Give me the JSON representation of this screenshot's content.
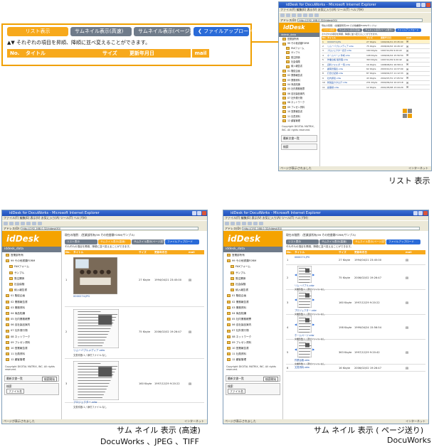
{
  "zoom": {
    "buttons": [
      "リスト表示",
      "サムネイル表示(高速)",
      "サムネイル表示(ページ送り)",
      "ファイルアップロード"
    ],
    "note": "それぞれの項目を昇順、降順に並べ変えることができます。",
    "columns": [
      "No.",
      "タイトル",
      "サイズ",
      "更新年月日",
      "mail"
    ]
  },
  "common": {
    "window_title": "idDesk for DocuWorks - Microsoft Internet Explorer",
    "menu": "ファイル(F) 編集(E) 表示(V) お気に入り(A) ツール(T) ヘルプ(H)",
    "address_label": "アドレス(D)",
    "address": "http://192.168.0.32/iddesk30/",
    "status": "ページが表示されました",
    "zone": "インターネット",
    "logo": "idDesk",
    "project": "iddesk_data",
    "breadcrumb": "現在の階層：/営業部所有/99 その他書類FORM/サンプル/",
    "tabs": [
      "リスト表示",
      "サムネイル表示(高速)",
      "サムネイル表示(ページ送り)",
      "ファイルアップロード"
    ],
    "note": "それぞれの項目を昇順、降順に並べ変えることができます。",
    "columns": [
      "No.",
      "タイトル",
      "サイズ",
      "更新年月日",
      "mail"
    ],
    "sidebar": [
      "営業部所有",
      "99 その他書類FORM",
      "FAXフォーム",
      "サンプル",
      "受注関係",
      "社会保険",
      "納入報告書",
      "01 販促企画",
      "02 業務報告書",
      "03 業務資料",
      "04 商品知識",
      "05 社内業務帳票",
      "06 自社製品案内",
      "07 社外発行物",
      "08 ネットワーク",
      "09 プレゼン資料",
      "10 営業報告書",
      "11 社員資料",
      "12 顧客管理"
    ],
    "copyright": "Copyright DIGITAL MATRIX, INC. All rights reserved.",
    "search_title": "最新文書一覧",
    "search_button": "検索開始",
    "search_title2": "検索",
    "search_field": "ファイル名"
  },
  "list_rows": [
    {
      "no": "1",
      "title": "0000274.JPG",
      "size": "27 Kbyte",
      "date": "1994/04/21 23:45:00"
    },
    {
      "no": "2",
      "title": "リムーバブルメディア.xdw",
      "size": "75 Kbyte",
      "date": "2006/02/02 19:26:47"
    },
    {
      "no": "3",
      "title": "プロジェクター表示.xdw",
      "size": "160 Kbyte",
      "date": "1997/12/29 9:20:22"
    },
    {
      "no": "4",
      "title": "ホームページ 作成.xdw",
      "size": "198 Kbyte",
      "date": "1999/04/24 15:56:54"
    },
    {
      "no": "5",
      "title": "作業台帳 版管理.xdw",
      "size": "363 Kbyte",
      "date": "1997/12/29 9:20:42"
    },
    {
      "no": "6",
      "title": "資料フォルダ 一覧.xdw",
      "size": "16 Kbyte",
      "date": "1998/06/01 16:58:11"
    },
    {
      "no": "7",
      "title": "顧客管理表.xdw",
      "size": "62 Kbyte",
      "date": "2003/12/11 14:37:09"
    },
    {
      "no": "8",
      "title": "打合せ記録.xdw",
      "size": "87 Kbyte",
      "date": "1999/02/17 11:12:33"
    },
    {
      "no": "9",
      "title": "社内通達.xdw",
      "size": "43 Kbyte",
      "date": "2002/07/31 17:05:52"
    },
    {
      "no": "10",
      "title": "新製品カタログ.xdw",
      "size": "231 Kbyte",
      "date": "2004/09/14 10:22:18"
    },
    {
      "no": "11",
      "title": "議事録.xdw",
      "size": "12 Kbyte",
      "date": "2001/05/08 13:44:29"
    }
  ],
  "fast_rows": [
    {
      "no": "1",
      "title": "0000274.JPG",
      "size": "27 Kbyte",
      "date": "1994/04/21 23:45:00",
      "info": ""
    },
    {
      "no": "2",
      "title": "リムーバブルメディア.xdw",
      "size": "75 Kbyte",
      "date": "2006/02/02 19:26:47",
      "info": "文書件数:1 / 添付ファイル:なし"
    },
    {
      "no": "3",
      "title": "プロジェクター.xdw",
      "size": "160 Kbyte",
      "date": "1997/12/29 9:20:22",
      "info": "文書件数:1 / 添付ファイル:なし"
    }
  ],
  "page_rows": [
    {
      "no": "1",
      "title": "0000274.JPG",
      "size": "27 Kbyte",
      "date": "1994/04/21 23:45:00",
      "info": ""
    },
    {
      "no": "2",
      "title": "リムーバブル.xdw",
      "size": "75 Kbyte",
      "date": "2006/02/02 19:26:47",
      "info": "文書件数:1 / 添付ファイル:なし"
    },
    {
      "no": "3",
      "title": "プロジェクター.xdw",
      "size": "160 Kbyte",
      "date": "1997/12/29 9:20:22",
      "info": "文書件数:1 / 添付ファイル:なし"
    },
    {
      "no": "4",
      "title": "ホームページ.xdw",
      "size": "198 Kbyte",
      "date": "1999/04/24 15:56:54",
      "info": "文書件数:1 / 添付ファイル:なし"
    },
    {
      "no": "5",
      "title": "作業台帳.xdw",
      "size": "363 Kbyte",
      "date": "1997/12/29 9:20:42",
      "info": "文書件数:1 / 添付ファイル:なし"
    },
    {
      "no": "6",
      "title": "文書資料.xdw",
      "size": "16 Kbyte",
      "date": "2006/02/02 19:26:47",
      "info": ""
    }
  ],
  "captions": {
    "list": "リスト 表示",
    "fast_line1": "サム ネイル 表示 (高速)",
    "fast_line2": "DocuWorks 、JPEG 、TIFF",
    "page_line1": "サム ネイル 表示 ( ページ送り)",
    "page_line2": "DocuWorks"
  },
  "colors": {
    "orange": "#f7a91c",
    "tab_gray": "#6f7b8a",
    "tab_blue": "#2a6bd8",
    "highlight": "#f0a000"
  }
}
